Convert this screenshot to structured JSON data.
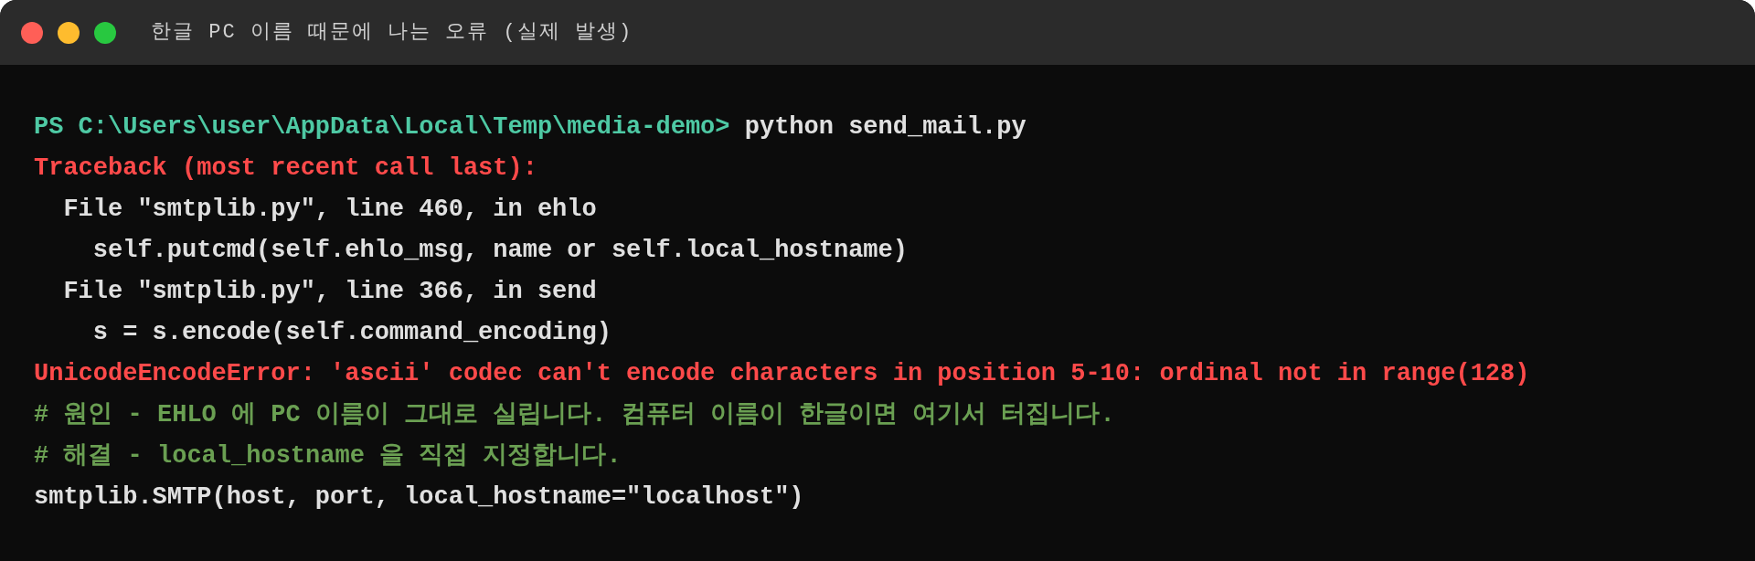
{
  "window": {
    "title": "한글 PC 이름 때문에 나는 오류 (실제 발생)"
  },
  "lines": [
    {
      "kind": "prompt",
      "prompt": "PS C:\\Users\\user\\AppData\\Local\\Temp\\media-demo>",
      "command": "python send_mail.py"
    },
    {
      "kind": "error",
      "text": "Traceback (most recent call last):"
    },
    {
      "kind": "plain",
      "text": "  File \"smtplib.py\", line 460, in ehlo"
    },
    {
      "kind": "plain",
      "text": "    self.putcmd(self.ehlo_msg, name or self.local_hostname)"
    },
    {
      "kind": "plain",
      "text": "  File \"smtplib.py\", line 366, in send"
    },
    {
      "kind": "plain",
      "text": "    s = s.encode(self.command_encoding)"
    },
    {
      "kind": "error",
      "text": "UnicodeEncodeError: 'ascii' codec can't encode characters in position 5-10: ordinal not in range(128)"
    },
    {
      "kind": "comment",
      "text": "# 원인 - EHLO 에 PC 이름이 그대로 실립니다. 컴퓨터 이름이 한글이면 여기서 터집니다."
    },
    {
      "kind": "comment",
      "text": "# 해결 - local_hostname 을 직접 지정합니다."
    },
    {
      "kind": "plain",
      "text": "smtplib.SMTP(host, port, local_hostname=\"localhost\")"
    }
  ]
}
